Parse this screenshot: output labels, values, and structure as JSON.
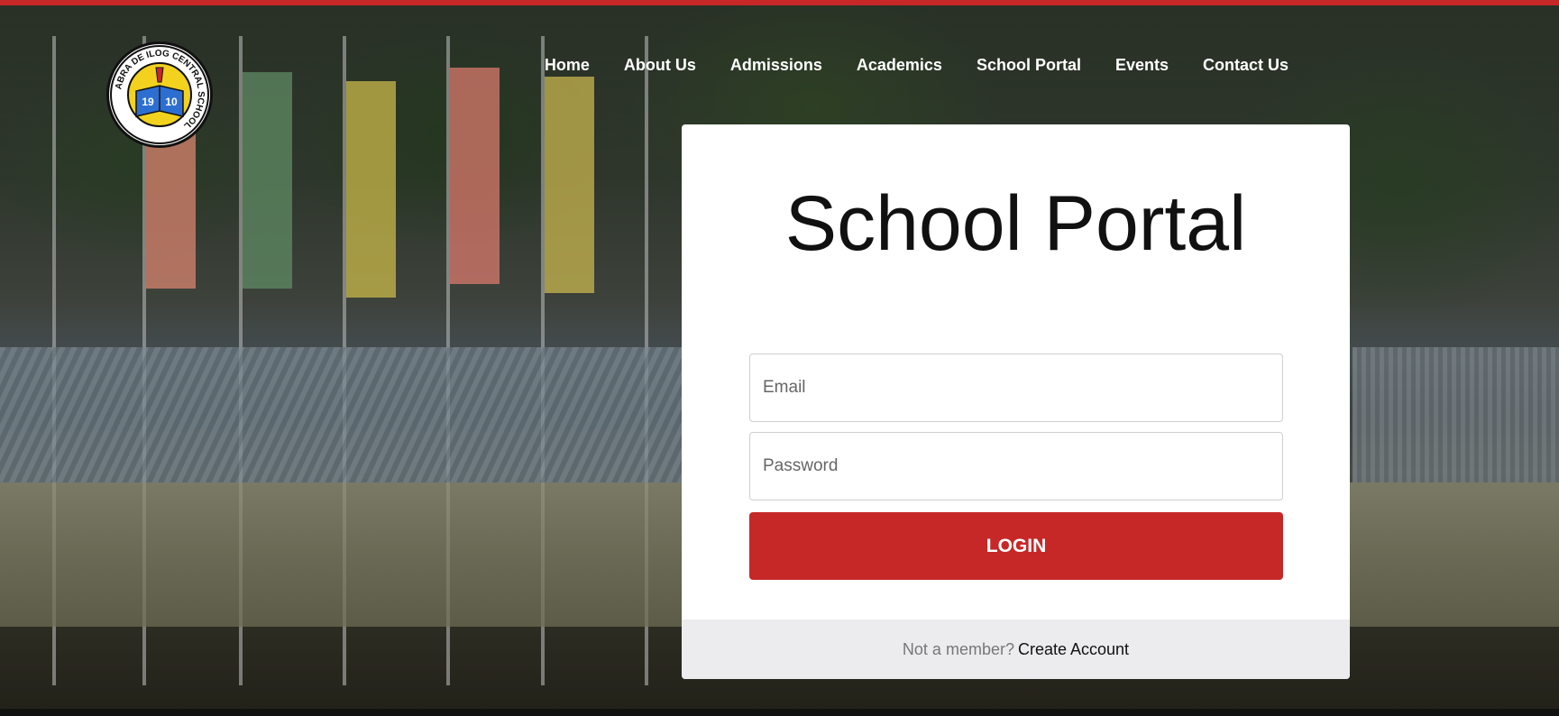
{
  "colors": {
    "accent": "#c62828",
    "card_bg": "#ffffff",
    "footer_bg": "#ececef"
  },
  "logo": {
    "icon": "school-seal-icon",
    "ring_text": "ABRA DE ILOG CENTRAL SCHOOL",
    "year_left": "19",
    "year_right": "10"
  },
  "nav": {
    "items": [
      {
        "label": "Home"
      },
      {
        "label": "About Us"
      },
      {
        "label": "Admissions"
      },
      {
        "label": "Academics"
      },
      {
        "label": "School Portal"
      },
      {
        "label": "Events"
      },
      {
        "label": "Contact Us"
      }
    ]
  },
  "portal": {
    "title": "School Portal",
    "email_placeholder": "Email",
    "password_placeholder": "Password",
    "login_label": "LOGIN",
    "footer_prompt": "Not a member?",
    "footer_link": "Create Account"
  }
}
